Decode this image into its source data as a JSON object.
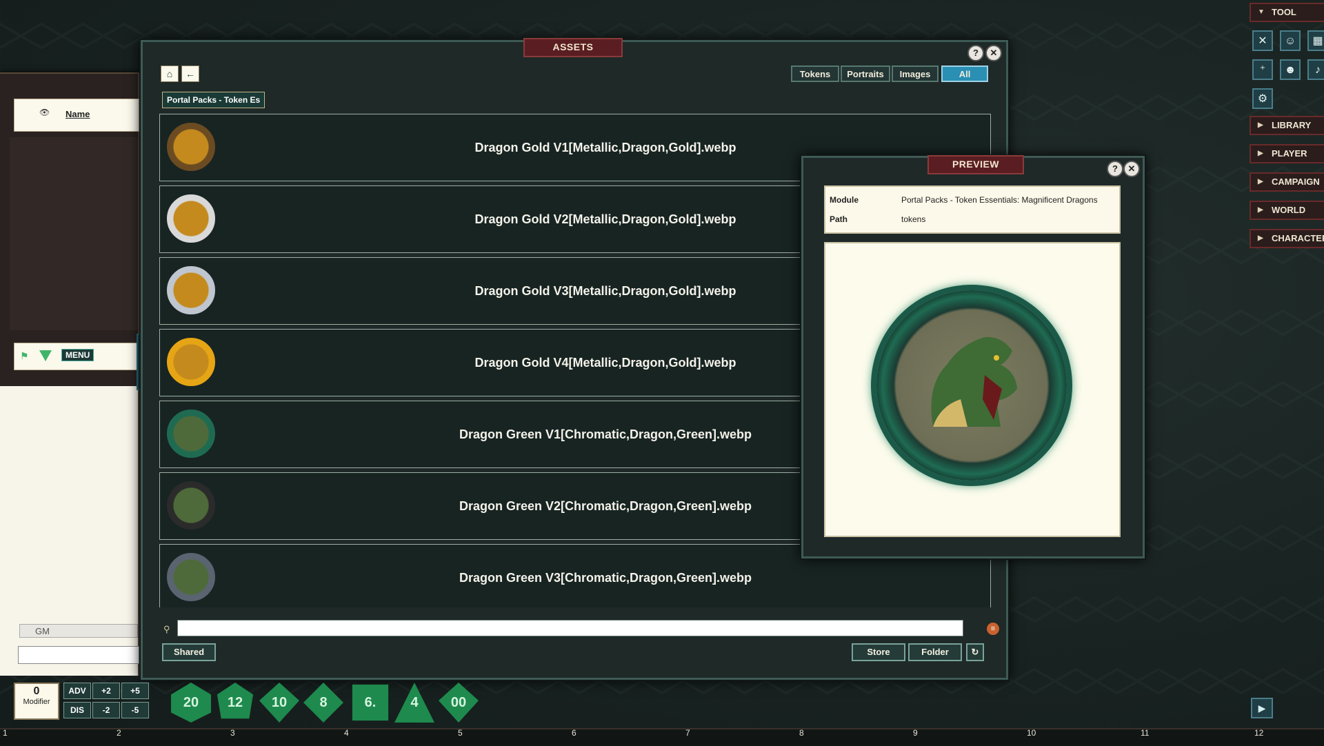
{
  "assets": {
    "title": "ASSETS",
    "help": "?",
    "close": "✕",
    "filters": [
      "Tokens",
      "Portraits",
      "Images",
      "All"
    ],
    "breadcrumb": "Portal Packs - Token Es",
    "rows": [
      {
        "label": "Dragon Gold V1[Metallic,Dragon,Gold].webp",
        "ring": "#6b4b22",
        "fill": "#c48a1e"
      },
      {
        "label": "Dragon Gold V2[Metallic,Dragon,Gold].webp",
        "ring": "#d9d9d9",
        "fill": "#c48a1e"
      },
      {
        "label": "Dragon Gold V3[Metallic,Dragon,Gold].webp",
        "ring": "#bfc6cf",
        "fill": "#c48a1e"
      },
      {
        "label": "Dragon Gold V4[Metallic,Dragon,Gold].webp",
        "ring": "#e6a515",
        "fill": "#c48a1e"
      },
      {
        "label": "Dragon Green V1[Chromatic,Dragon,Green].webp",
        "ring": "#1f6b52",
        "fill": "#4f6a3a"
      },
      {
        "label": "Dragon Green V2[Chromatic,Dragon,Green].webp",
        "ring": "#2b2b2b",
        "fill": "#4f6a3a"
      },
      {
        "label": "Dragon Green V3[Chromatic,Dragon,Green].webp",
        "ring": "#5a6470",
        "fill": "#4f6a3a"
      }
    ],
    "search_placeholder": "",
    "buttons": {
      "shared": "Shared",
      "store": "Store",
      "folder": "Folder"
    }
  },
  "preview": {
    "title": "PREVIEW",
    "module_key": "Module",
    "module_val": "Portal Packs - Token Essentials: Magnificent Dragons",
    "path_key": "Path",
    "path_val": "tokens"
  },
  "left": {
    "name_header": "Name",
    "menu": "MENU",
    "gm": "GM"
  },
  "sidebar": {
    "tool": "TOOL",
    "tabs": [
      "LIBRARY",
      "PLAYER",
      "CAMPAIGN",
      "WORLD",
      "CHARACTER"
    ]
  },
  "modifier": {
    "value": "0",
    "label": "Modifier"
  },
  "mods": [
    "ADV",
    "+2",
    "+5",
    "DIS",
    "-2",
    "-5"
  ],
  "dice": [
    "20",
    "12",
    "10",
    "8",
    "6.",
    "4",
    "00"
  ],
  "ruler": [
    "1",
    "2",
    "3",
    "4",
    "5",
    "6",
    "7",
    "8",
    "9",
    "10",
    "11",
    "12"
  ]
}
